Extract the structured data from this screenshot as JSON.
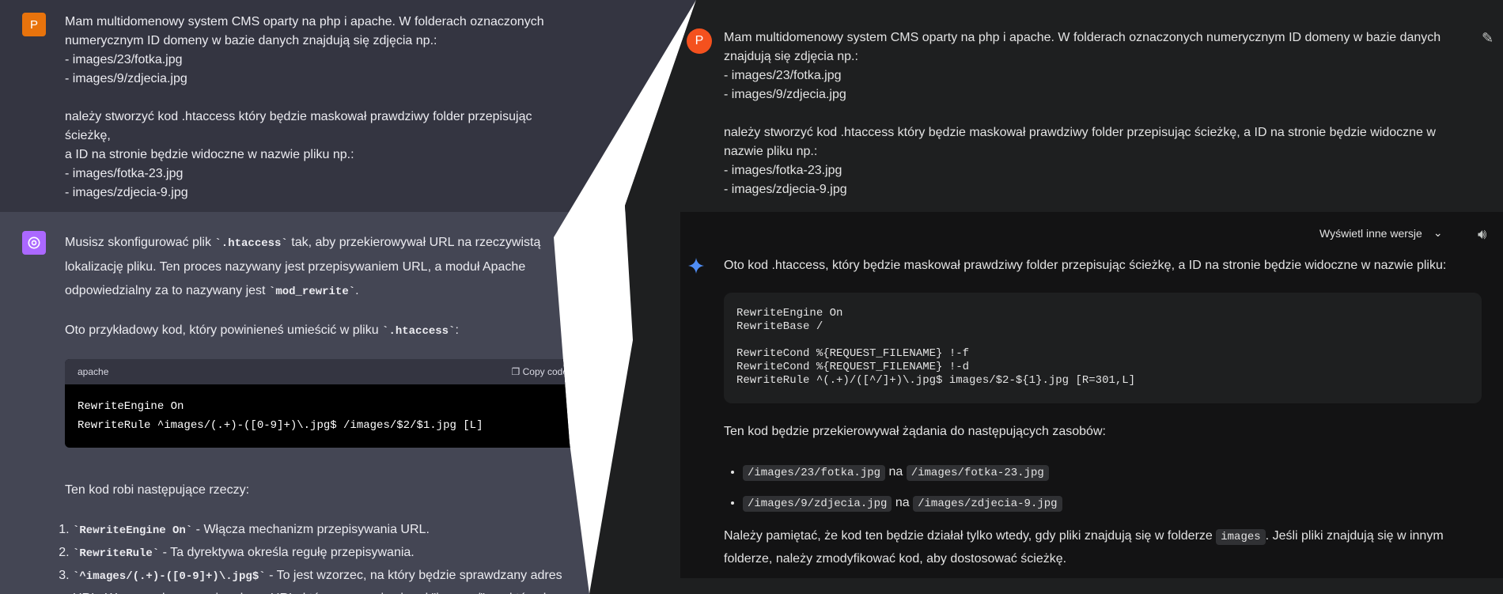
{
  "left": {
    "user_avatar": "P",
    "user_lines": [
      "Mam multidomenowy system CMS oparty na php i apache. W folderach oznaczonych",
      "numerycznym ID domeny w bazie danych znajdują się zdjęcia np.:",
      "- images/23/fotka.jpg",
      "- images/9/zdjecia.jpg",
      "",
      "należy stworzyć kod .htaccess który będzie maskował prawdziwy folder przepisując ścieżkę,",
      "a ID na stronie będzie widoczne w nazwie pliku np.:",
      "- images/fotka-23.jpg",
      "- images/zdjecia-9.jpg"
    ],
    "intro_1": "Musisz skonfigurować plik ",
    "intro_code_1": "`.htaccess`",
    "intro_2": " tak, aby przekierowywał URL na rzeczywistą lokalizację pliku. Ten proces nazywany jest przepisywaniem URL, a moduł Apache odpowiedzialny za to nazywany jest ",
    "intro_code_2": "`mod_rewrite`",
    "intro_3": ".",
    "example_1": "Oto przykładowy kod, który powinieneś umieścić w pliku ",
    "example_code": "`.htaccess`",
    "example_2": ":",
    "code_lang": "apache",
    "copy_label": "Copy code",
    "code": "RewriteEngine On\nRewriteRule ^images/(.+)-([0-9]+)\\.jpg$ /images/$2/$1.jpg [L]",
    "explain": "Ten kod robi następujące rzeczy:",
    "steps": [
      {
        "code": "`RewriteEngine On`",
        "text": " - Włącza mechanizm przepisywania URL."
      },
      {
        "code": "`RewriteRule`",
        "text": " - Ta dyrektywa określa regułę przepisywania."
      },
      {
        "code": "`^images/(.+)-([0-9]+)\\.jpg$`",
        "text": " - To jest wzorzec, na który będzie sprawdzany adres URL. Wzorzec dopasowuje adresy URL, które zaczynają się od \"images/\", po których"
      }
    ]
  },
  "right": {
    "user_avatar": "P",
    "user_lines": [
      "Mam multidomenowy system CMS oparty na php i apache. W folderach oznaczonych numerycznym ID domeny w bazie danych",
      "znajdują się zdjęcia np.:",
      "- images/23/fotka.jpg",
      "- images/9/zdjecia.jpg",
      "",
      "należy stworzyć kod .htaccess który będzie maskował prawdziwy folder przepisując ścieżkę, a ID na stronie będzie widoczne w",
      "nazwie pliku np.:",
      "- images/fotka-23.jpg",
      "- images/zdjecia-9.jpg"
    ],
    "versions_label": "Wyświetl inne wersje",
    "answer_intro": "Oto kod .htaccess, który będzie maskował prawdziwy folder przepisując ścieżkę, a ID na stronie będzie widoczne w nazwie pliku:",
    "code": "RewriteEngine On\nRewriteBase /\n\nRewriteCond %{REQUEST_FILENAME} !-f\nRewriteCond %{REQUEST_FILENAME} !-d\nRewriteRule ^(.+)/([^/]+)\\.jpg$ images/$2-${1}.jpg [R=301,L]",
    "redirect_text": "Ten kod będzie przekierowywał żądania do następujących zasobów:",
    "bullets": [
      {
        "from": "/images/23/fotka.jpg",
        "sep": " na ",
        "to": "/images/fotka-23.jpg"
      },
      {
        "from": "/images/9/zdjecia.jpg",
        "sep": " na ",
        "to": "/images/zdjecia-9.jpg"
      }
    ],
    "note_1": "Należy pamiętać, że kod ten będzie działał tylko wtedy, gdy pliki znajdują się w folderze ",
    "note_chip": "images",
    "note_2": ". Jeśli pliki znajdują się w innym",
    "note_3": "folderze, należy zmodyfikować kod, aby dostosować ścieżkę."
  },
  "colors": {
    "left_user_bg": "#343541",
    "left_assistant_bg": "#444654",
    "right_bg": "#131314",
    "avatar_orange": "#e8730c"
  }
}
